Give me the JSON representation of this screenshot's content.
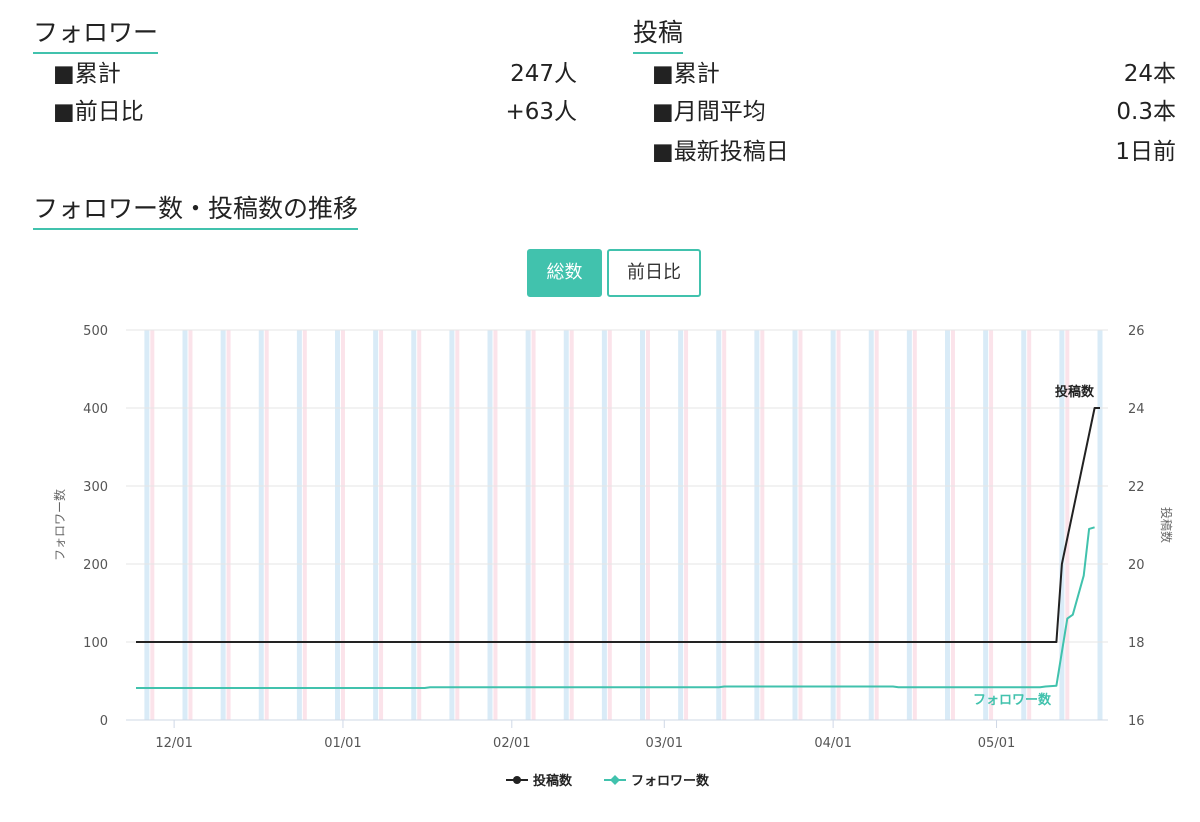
{
  "followers": {
    "heading": "フォロワー",
    "rows": [
      {
        "label": "■累計",
        "value": "247人"
      },
      {
        "label": "■前日比",
        "value": "+63人"
      }
    ]
  },
  "posts": {
    "heading": "投稿",
    "rows": [
      {
        "label": "■累計",
        "value": "24本"
      },
      {
        "label": "■月間平均",
        "value": "0.3本"
      },
      {
        "label": "■最新投稿日",
        "value": "1日前"
      }
    ]
  },
  "trend": {
    "heading": "フォロワー数・投稿数の推移",
    "buttons": {
      "total": "総数",
      "diff": "前日比"
    }
  },
  "colors": {
    "accent": "#41c2ad",
    "posts_line": "#222222",
    "followers_line": "#41c2ad",
    "weekday_band": "#d9ebf7",
    "weekend_band": "#fbe3ea"
  },
  "chart_data": {
    "type": "line",
    "x_ticks": [
      "12/01",
      "01/01",
      "02/01",
      "03/01",
      "04/01",
      "05/01"
    ],
    "y_left": {
      "label": "フォロワー数",
      "range": [
        0,
        500
      ],
      "ticks": [
        0,
        100,
        200,
        300,
        400,
        500
      ]
    },
    "y_right": {
      "label": "投稿数",
      "range": [
        16,
        26
      ],
      "ticks": [
        16,
        18,
        20,
        22,
        24,
        26
      ]
    },
    "grid": true,
    "legend_position": "bottom-center",
    "series": [
      {
        "name": "投稿数",
        "axis": "right",
        "color": "#222222",
        "end_label": "投稿数",
        "points": [
          [
            "11/24",
            18
          ],
          [
            "05/12",
            18
          ],
          [
            "05/13",
            20
          ],
          [
            "05/19",
            24
          ],
          [
            "05/20",
            24
          ]
        ]
      },
      {
        "name": "フォロワー数",
        "axis": "left",
        "color": "#41c2ad",
        "end_label": "フォロワー数",
        "points": [
          [
            "11/24",
            41
          ],
          [
            "01/16",
            41
          ],
          [
            "01/17",
            42
          ],
          [
            "03/11",
            42
          ],
          [
            "03/12",
            43
          ],
          [
            "04/12",
            43
          ],
          [
            "04/13",
            42
          ],
          [
            "05/09",
            42
          ],
          [
            "05/10",
            43
          ],
          [
            "05/12",
            44
          ],
          [
            "05/14",
            130
          ],
          [
            "05/15",
            135
          ],
          [
            "05/17",
            185
          ],
          [
            "05/18",
            245
          ],
          [
            "05/19",
            247
          ]
        ]
      }
    ]
  }
}
